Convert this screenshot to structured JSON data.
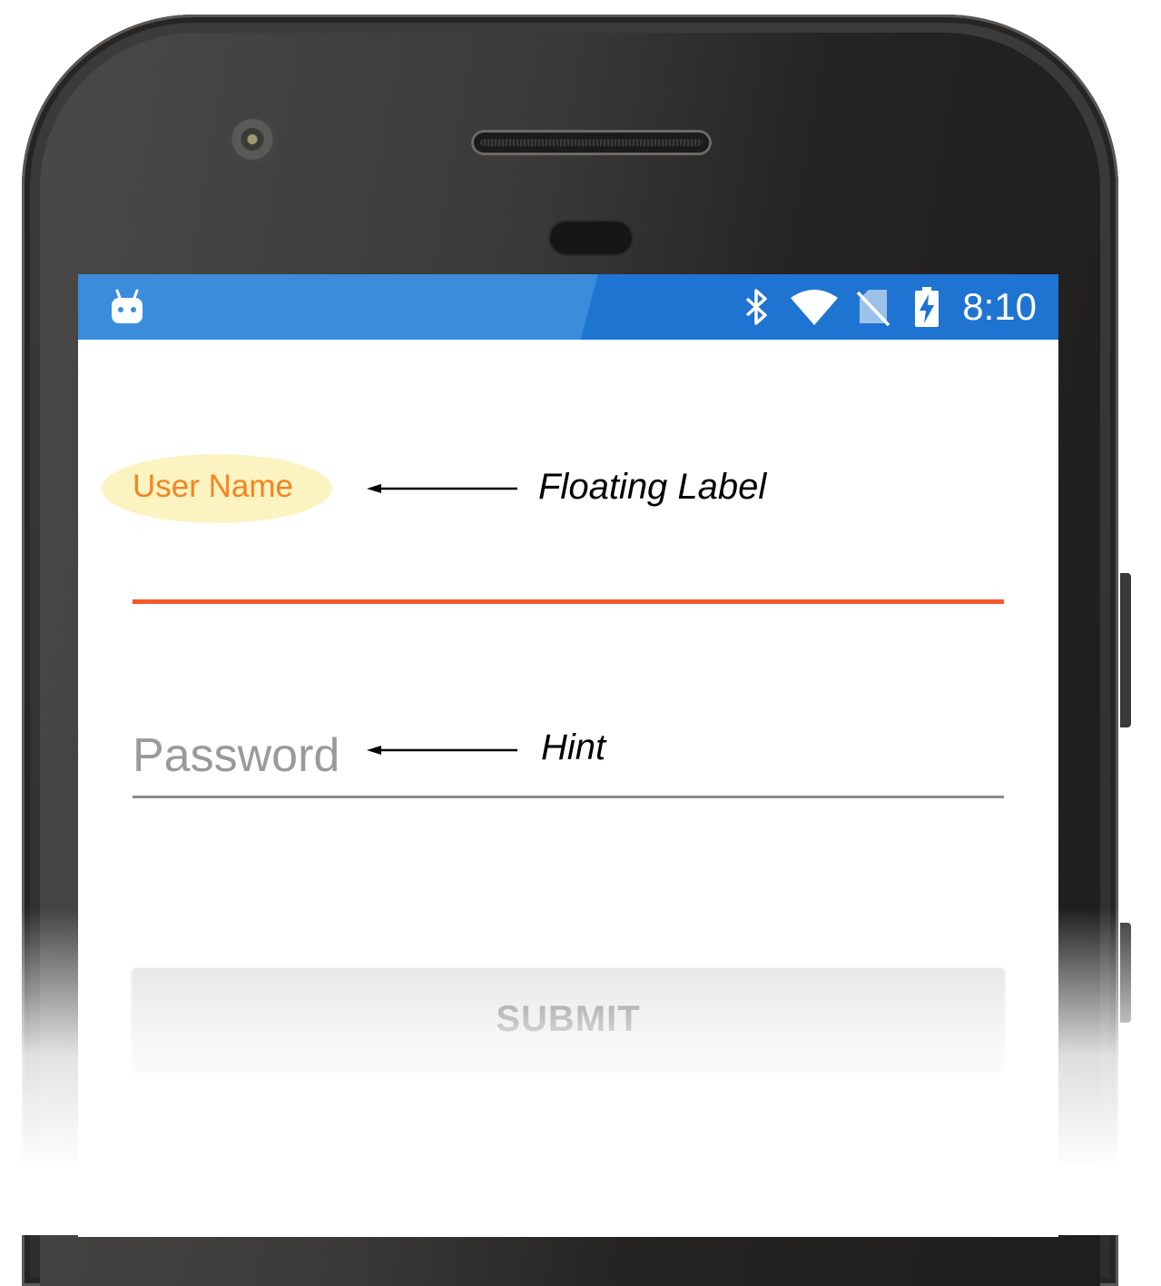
{
  "status_bar": {
    "time": "8:10",
    "background_color": "#1f74d2",
    "icons": [
      "android-bot-icon",
      "bluetooth-icon",
      "wifi-icon",
      "no-sim-icon",
      "battery-charging-icon"
    ]
  },
  "form": {
    "username": {
      "floating_label": "User Name",
      "label_color": "#f5841f",
      "underline_color": "#f5592a",
      "value": ""
    },
    "password": {
      "placeholder": "Password",
      "value": ""
    },
    "submit_label": "SUBMIT"
  },
  "annotations": {
    "floating_label": "Floating Label",
    "hint": "Hint"
  }
}
